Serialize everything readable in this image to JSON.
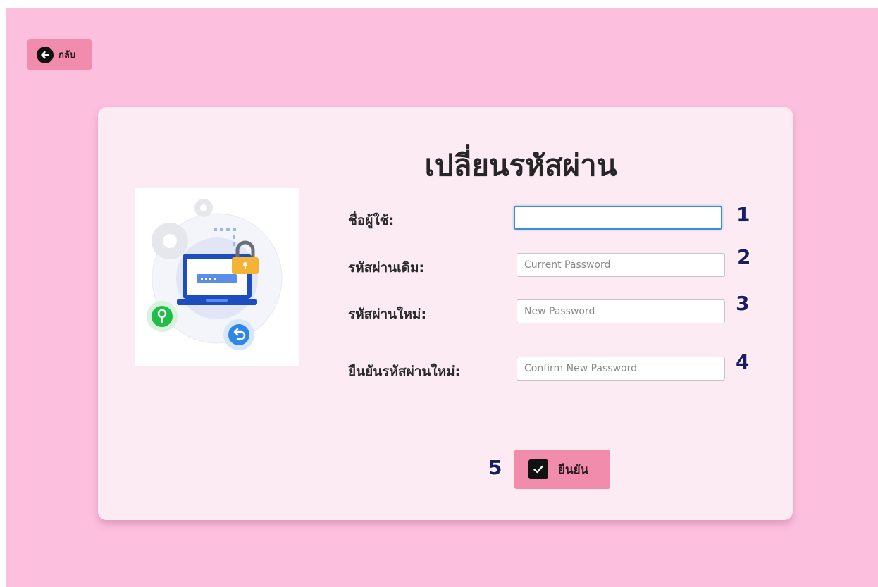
{
  "back_button": {
    "label": "กลับ",
    "icon": "arrow-left-circle-icon"
  },
  "form": {
    "title": "เปลี่ยนรหัสผ่าน",
    "fields": [
      {
        "label": "ชื่อผู้ใช้:",
        "value": "",
        "placeholder": "",
        "marker": "1"
      },
      {
        "label": "รหัสผ่านเดิม:",
        "value": "",
        "placeholder": "Current Password",
        "marker": "2"
      },
      {
        "label": "รหัสผ่านใหม่:",
        "value": "",
        "placeholder": "New Password",
        "marker": "3"
      },
      {
        "label": "ยืนยันรหัสผ่านใหม่:",
        "value": "",
        "placeholder": "Confirm New Password",
        "marker": "4"
      }
    ],
    "submit": {
      "label": "ยืนยัน",
      "marker": "5",
      "icon": "checkbox-check-icon"
    }
  },
  "colors": {
    "page_background": "#fdbfde",
    "card_background": "#fdebf3",
    "button_background": "#f28cad",
    "marker_color": "#1d1b68",
    "focus_border": "#3a8dde"
  }
}
